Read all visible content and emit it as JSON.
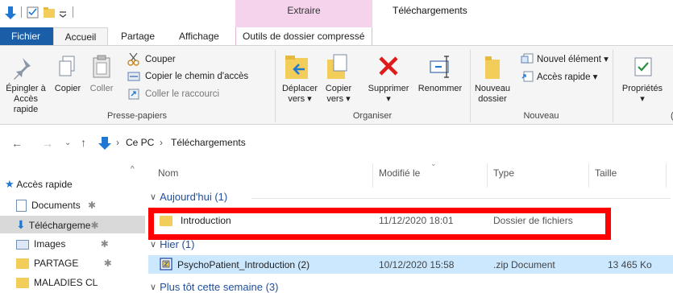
{
  "titlebar": {
    "context_tab": "Extraire",
    "window_title": "Téléchargements"
  },
  "tabs": {
    "file": "Fichier",
    "home": "Accueil",
    "share": "Partage",
    "view": "Affichage",
    "zip_tools": "Outils de dossier compressé"
  },
  "ribbon": {
    "clipboard": {
      "pin_line1": "Épingler à",
      "pin_line2": "Accès rapide",
      "copy": "Copier",
      "paste": "Coller",
      "cut": "Couper",
      "copy_path": "Copier le chemin d'accès",
      "paste_shortcut": "Coller le raccourci",
      "group_label": "Presse-papiers"
    },
    "organize": {
      "move_line1": "Déplacer",
      "move_line2": "vers ▾",
      "copy_line1": "Copier",
      "copy_line2": "vers ▾",
      "delete": "Supprimer",
      "rename": "Renommer",
      "group_label": "Organiser"
    },
    "new": {
      "new_folder_line1": "Nouveau",
      "new_folder_line2": "dossier",
      "new_item": "Nouvel élément ▾",
      "easy_access": "Accès rapide ▾",
      "group_label": "Nouveau"
    },
    "open": {
      "properties": "Propriétés"
    }
  },
  "address": {
    "crumb_root": "Ce PC",
    "crumb_current": "Téléchargements"
  },
  "nav": {
    "items": [
      {
        "label": "Accès rapide"
      },
      {
        "label": "Documents"
      },
      {
        "label": "Téléchargeme"
      },
      {
        "label": "Images"
      },
      {
        "label": "PARTAGE"
      },
      {
        "label": "MALADIES CL"
      }
    ]
  },
  "columns": {
    "name": "Nom",
    "modified": "Modifié le",
    "type": "Type",
    "size": "Taille"
  },
  "groups": {
    "today": "Aujourd'hui (1)",
    "yesterday": "Hier (1)",
    "earlier_week": "Plus tôt cette semaine (3)"
  },
  "files": [
    {
      "name": "Introduction",
      "modified": "11/12/2020 18:01",
      "type": "Dossier de fichiers",
      "size": ""
    },
    {
      "name": "PsychoPatient_Introduction (2)",
      "modified": "10/12/2020 15:58",
      "type": ".zip Document",
      "size": "13 465 Ko"
    }
  ],
  "colors": {
    "file_tab": "#1a5ea8",
    "context_band": "#f6d3ec",
    "selection": "#cce8ff",
    "highlight_box": "#ff0000",
    "folder": "#f3cd5a"
  }
}
